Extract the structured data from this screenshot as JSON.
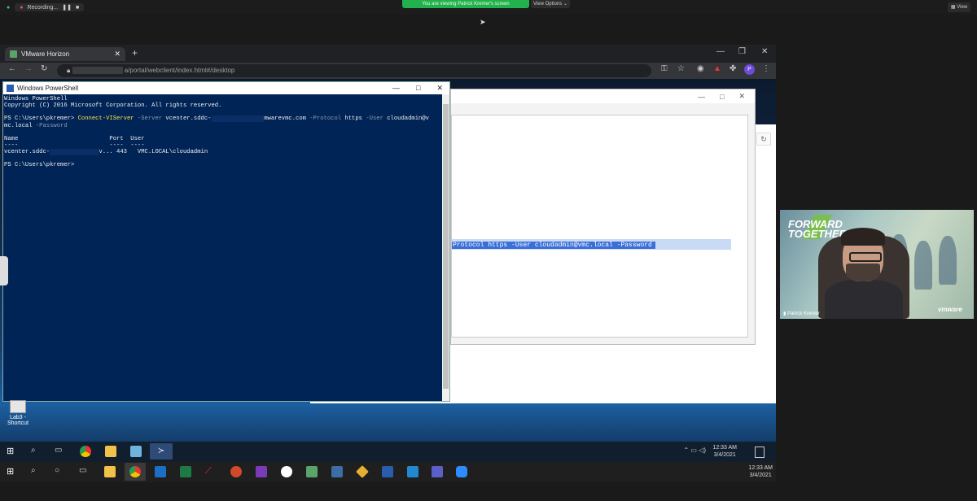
{
  "zoom": {
    "recording_label": "Recording...",
    "banner": "You are viewing Patrick Kremer's screen",
    "view_options": "View Options",
    "view_label": "View"
  },
  "browser": {
    "tab_title": "VMware Horizon",
    "address": "a/portal/webclient/index.html#/desktop"
  },
  "powershell": {
    "title": "Windows PowerShell",
    "lines": {
      "l1": "Windows PowerShell",
      "l2": "Copyright (C) 2016 Microsoft Corporation. All rights reserved.",
      "prompt1": "PS C:\\Users\\pkremer> ",
      "cmd": "Connect-VIServer",
      "p_server": " -Server",
      "server_val": " vcenter.sddc-",
      "server_tail": "mwarevmc.com",
      "p_protocol": " -Protocol",
      "protocol_val": " https",
      "p_user": " -User",
      "user_val": " cloudadmin@v",
      "l4": "mc.local",
      "p_password": " -Password",
      "hdr": "Name                          Port  User",
      "dash": "----                          ----  ----",
      "row_name": "vcenter.sddc-",
      "row_tail": "v... 443   VMC.LOCAL\\cloudadmin",
      "prompt2": "PS C:\\Users\\pkremer>"
    }
  },
  "bg_window": {
    "selected_text": "Protocol https -User cloudadmin@vmc.local -Password"
  },
  "desktop_icon": {
    "label": "Lab3 - Shortcut"
  },
  "inner_clock": {
    "time": "12:33 AM",
    "date": "3/4/2021"
  },
  "outer_clock": {
    "time": "12:33 AM",
    "date": "3/4/2021"
  },
  "webcam": {
    "name": "Patrick Kremer",
    "brand": "vmware",
    "banner": "FORWARD TOGETHER"
  },
  "colors": {
    "ps_bg": "#012456",
    "zoom_green": "#23b14d",
    "selection": "#3a6fd8"
  }
}
